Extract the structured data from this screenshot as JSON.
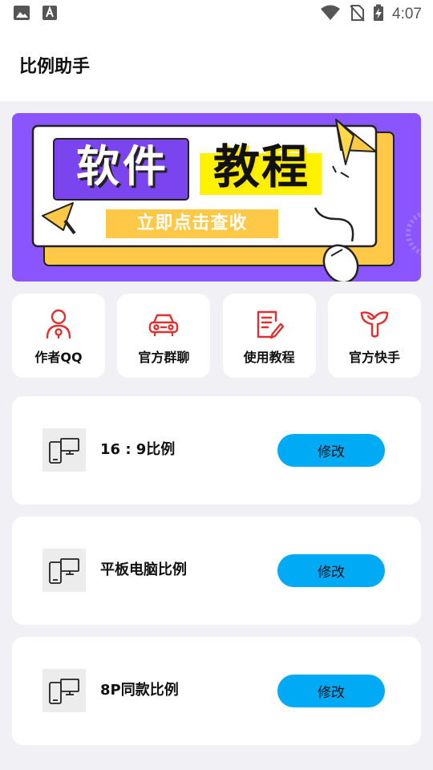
{
  "status_bar": {
    "time": "4:07",
    "left_icons": [
      "image-icon",
      "font-icon"
    ],
    "right_icons": [
      "wifi-icon",
      "no-sim-icon",
      "battery-charging-icon"
    ]
  },
  "app_bar": {
    "title": "比例助手"
  },
  "banner": {
    "title_part1": "软件",
    "title_part2": "教程",
    "cta": "立即点击查收",
    "colors": {
      "background": "#8a55ff",
      "card": "#ffffff",
      "accent": "#ffc846"
    }
  },
  "quick_actions": [
    {
      "label": "作者QQ",
      "icon": "person-icon"
    },
    {
      "label": "官方群聊",
      "icon": "car-icon"
    },
    {
      "label": "使用教程",
      "icon": "document-edit-icon"
    },
    {
      "label": "官方快手",
      "icon": "kuaishou-logo-icon"
    }
  ],
  "ratio_items": [
    {
      "label": "16 : 9比例",
      "button": "修改",
      "icon": "devices-icon"
    },
    {
      "label": "平板电脑比例",
      "button": "修改",
      "icon": "devices-icon"
    },
    {
      "label": "8P同款比例",
      "button": "修改",
      "icon": "devices-icon"
    }
  ],
  "colors": {
    "icon_red": "#e03030",
    "button_blue": "#00aaf5",
    "page_bg": "#f0f0f5"
  }
}
